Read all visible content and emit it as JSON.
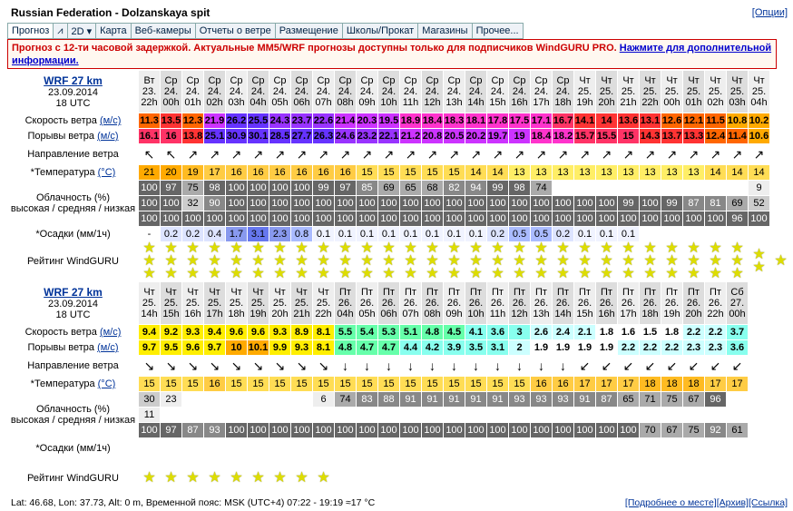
{
  "header": {
    "title": "Russian Federation - Dolzanskaya spit",
    "options": "[Опции]"
  },
  "tabs": [
    "Прогноз",
    "⩘",
    "2D ▾",
    "Карта",
    "Веб-камеры",
    "Отчеты о ветре",
    "Размещение",
    "Школы/Прокат",
    "Магазины",
    "Прочее..."
  ],
  "notice": {
    "text": "Прогноз с 12-ти часовой задержкой. Актуальные MM5/WRF прогнозы доступны только для подписчиков WindGURU PRO. ",
    "link": "Нажмите для дополнительной информации."
  },
  "labels": {
    "wind": "Скорость ветра",
    "wind_unit": "(м/с)",
    "gust": "Порывы ветра",
    "gust_unit": "(м/с)",
    "dir": "Направление ветра",
    "temp": "*Температура",
    "temp_unit": "(°C)",
    "cloud": "Облачность (%)",
    "cloud_sub": "высокая / средняя / низкая",
    "rain": "*Осадки (мм/1ч)",
    "rating": "Рейтинг WindGURU"
  },
  "m1": {
    "name": "WRF 27 km",
    "date": "23.09.2014",
    "utc": "18 UTC",
    "days": [
      "Вт",
      "Ср",
      "Ср",
      "Ср",
      "Ср",
      "Ср",
      "Ср",
      "Ср",
      "Ср",
      "Ср",
      "Ср",
      "Ср",
      "Ср",
      "Ср",
      "Ср",
      "Ср",
      "Ср",
      "Ср",
      "Ср",
      "Ср",
      "Чт",
      "Чт",
      "Чт",
      "Чт",
      "Чт",
      "Чт",
      "Чт",
      "Чт",
      "Чт"
    ],
    "dates": [
      "23.",
      "24.",
      "24.",
      "24.",
      "24.",
      "24.",
      "24.",
      "24.",
      "24.",
      "24.",
      "24.",
      "24.",
      "24.",
      "24.",
      "24.",
      "24.",
      "24.",
      "24.",
      "24.",
      "24.",
      "25.",
      "25.",
      "25.",
      "25.",
      "25.",
      "25.",
      "25.",
      "25.",
      "25."
    ],
    "hours": [
      "22h",
      "00h",
      "01h",
      "02h",
      "03h",
      "04h",
      "05h",
      "06h",
      "07h",
      "08h",
      "09h",
      "10h",
      "11h",
      "12h",
      "13h",
      "14h",
      "15h",
      "16h",
      "17h",
      "18h",
      "19h",
      "20h",
      "21h",
      "22h",
      "00h",
      "01h",
      "02h",
      "03h",
      "04h"
    ],
    "wind": [
      "11.3",
      "13.5",
      "12.3",
      "21.9",
      "26.2",
      "25.5",
      "24.3",
      "23.7",
      "22.6",
      "21.4",
      "20.3",
      "19.5",
      "18.9",
      "18.4",
      "18.3",
      "18.1",
      "17.8",
      "17.5",
      "17.1",
      "16.7",
      "14.1",
      "14",
      "13.6",
      "13.1",
      "12.6",
      "12.1",
      "11.5",
      "10.8",
      "10.2",
      "9.7"
    ],
    "gust": [
      "16.1",
      "16",
      "13.8",
      "25.1",
      "30.9",
      "30.1",
      "28.5",
      "27.7",
      "26.3",
      "24.6",
      "23.2",
      "22.1",
      "21.2",
      "20.8",
      "20.5",
      "20.2",
      "19.7",
      "19",
      "18.4",
      "18.2",
      "15.7",
      "15.5",
      "15",
      "14.3",
      "13.7",
      "13.3",
      "12.4",
      "11.4",
      "10.6",
      "10"
    ],
    "temp": [
      "21",
      "20",
      "19",
      "17",
      "16",
      "16",
      "16",
      "16",
      "16",
      "16",
      "15",
      "15",
      "15",
      "15",
      "15",
      "14",
      "14",
      "13",
      "13",
      "13",
      "13",
      "13",
      "13",
      "13",
      "13",
      "13",
      "14",
      "14",
      "14",
      "14"
    ],
    "cloud_h": [
      "100",
      "97",
      "75",
      "98",
      "100",
      "100",
      "100",
      "100",
      "99",
      "97",
      "85",
      "69",
      "65",
      "68",
      "82",
      "94",
      "99",
      "98",
      "74",
      "",
      "",
      "",
      "",
      "",
      "",
      "",
      "",
      "",
      "9",
      "23"
    ],
    "cloud_m": [
      "100",
      "100",
      "32",
      "90",
      "100",
      "100",
      "100",
      "100",
      "100",
      "100",
      "100",
      "100",
      "100",
      "100",
      "100",
      "100",
      "100",
      "100",
      "100",
      "100",
      "100",
      "100",
      "99",
      "100",
      "99",
      "87",
      "81",
      "69",
      "52",
      "30"
    ],
    "cloud_l": [
      "100",
      "100",
      "100",
      "100",
      "100",
      "100",
      "100",
      "100",
      "100",
      "100",
      "100",
      "100",
      "100",
      "100",
      "100",
      "100",
      "100",
      "100",
      "100",
      "100",
      "100",
      "100",
      "100",
      "100",
      "100",
      "100",
      "100",
      "96",
      "100",
      "100"
    ],
    "rain": [
      "-",
      "0.2",
      "0.2",
      "0.4",
      "1.7",
      "3.1",
      "2.3",
      "0.8",
      "0.1",
      "0.1",
      "0.1",
      "0.1",
      "0.1",
      "0.1",
      "0.1",
      "0.1",
      "0.2",
      "0.5",
      "0.5",
      "0.2",
      "0.1",
      "0.1",
      "0.1",
      "",
      "",
      "",
      "",
      "",
      "",
      ""
    ],
    "stars": [
      3,
      3,
      3,
      3,
      3,
      3,
      3,
      3,
      3,
      3,
      3,
      3,
      3,
      3,
      3,
      3,
      3,
      3,
      3,
      3,
      3,
      3,
      3,
      3,
      3,
      3,
      3,
      3,
      2,
      1
    ]
  },
  "m2": {
    "name": "WRF 27 km",
    "date": "23.09.2014",
    "utc": "18 UTC",
    "days": [
      "Чт",
      "Чт",
      "Чт",
      "Чт",
      "Чт",
      "Чт",
      "Чт",
      "Чт",
      "Чт",
      "Пт",
      "Пт",
      "Пт",
      "Пт",
      "Пт",
      "Пт",
      "Пт",
      "Пт",
      "Пт",
      "Пт",
      "Пт",
      "Пт",
      "Пт",
      "Пт",
      "Пт",
      "Пт",
      "Пт",
      "Пт",
      "Сб"
    ],
    "dates": [
      "25.",
      "25.",
      "25.",
      "25.",
      "25.",
      "25.",
      "25.",
      "25.",
      "25.",
      "26.",
      "26.",
      "26.",
      "26.",
      "26.",
      "26.",
      "26.",
      "26.",
      "26.",
      "26.",
      "26.",
      "26.",
      "26.",
      "26.",
      "26.",
      "26.",
      "26.",
      "26.",
      "27."
    ],
    "hours": [
      "14h",
      "15h",
      "16h",
      "17h",
      "18h",
      "19h",
      "20h",
      "21h",
      "22h",
      "04h",
      "05h",
      "06h",
      "07h",
      "08h",
      "09h",
      "10h",
      "11h",
      "12h",
      "13h",
      "14h",
      "15h",
      "16h",
      "17h",
      "18h",
      "19h",
      "20h",
      "22h",
      "00h"
    ],
    "wind": [
      "9.4",
      "9.2",
      "9.3",
      "9.4",
      "9.6",
      "9.6",
      "9.3",
      "8.9",
      "8.1",
      "5.5",
      "5.4",
      "5.3",
      "5.1",
      "4.8",
      "4.5",
      "4.1",
      "3.6",
      "3",
      "2.6",
      "2.4",
      "2.1",
      "1.8",
      "1.6",
      "1.5",
      "1.8",
      "2.2",
      "2.2",
      "3.7"
    ],
    "gust": [
      "9.7",
      "9.5",
      "9.6",
      "9.7",
      "10",
      "10.1",
      "9.9",
      "9.3",
      "8.1",
      "4.8",
      "4.7",
      "4.7",
      "4.4",
      "4.2",
      "3.9",
      "3.5",
      "3.1",
      "2",
      "1.9",
      "1.9",
      "1.9",
      "1.9",
      "2.2",
      "2.2",
      "2.2",
      "2.3",
      "2.3",
      "3.6"
    ],
    "temp": [
      "15",
      "15",
      "15",
      "16",
      "15",
      "15",
      "15",
      "15",
      "15",
      "15",
      "15",
      "15",
      "15",
      "15",
      "15",
      "15",
      "15",
      "15",
      "16",
      "16",
      "17",
      "17",
      "17",
      "18",
      "18",
      "18",
      "17",
      "17"
    ],
    "cloud_h": [
      "30",
      "23",
      "",
      "",
      "",
      "",
      "",
      "",
      "6",
      "74",
      "83",
      "88",
      "91",
      "91",
      "91",
      "91",
      "91",
      "93",
      "93",
      "93",
      "91",
      "87",
      "65",
      "71",
      "75",
      "67",
      "96",
      ""
    ],
    "cloud_m": [
      "11",
      "",
      "",
      "",
      "",
      "",
      "",
      "",
      "",
      "",
      "",
      "",
      "",
      "",
      "",
      "",
      "",
      "",
      "",
      "",
      "",
      "",
      "",
      "",
      "",
      "",
      "",
      ""
    ],
    "cloud_l": [
      "100",
      "97",
      "87",
      "93",
      "100",
      "100",
      "100",
      "100",
      "100",
      "100",
      "100",
      "100",
      "100",
      "100",
      "100",
      "100",
      "100",
      "100",
      "100",
      "100",
      "100",
      "100",
      "100",
      "70",
      "67",
      "75",
      "92",
      "61"
    ],
    "stars": [
      1,
      1,
      1,
      1,
      1,
      1,
      1,
      1,
      1
    ]
  },
  "footer": {
    "left": "Lat: 46.68, Lon: 37.73, Alt: 0 m, Временной пояс: MSK (UTC+4)  07:22 - 19:19  ≈17 °C",
    "links": [
      "[Подробнее о месте]",
      "[Архив]",
      "[Ссылка]"
    ]
  }
}
